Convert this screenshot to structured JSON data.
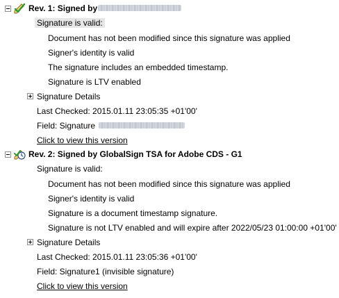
{
  "rev1": {
    "title": "Rev. 1: Signed by",
    "status": "Signature is valid:",
    "items": [
      "Document has not been modified since this signature was applied",
      "Signer's identity is valid",
      "The signature includes an embedded timestamp.",
      "Signature is LTV enabled"
    ],
    "details": "Signature Details",
    "last_checked": "Last Checked: 2015.01.11 23:05:35 +01'00'",
    "field": "Field: Signature",
    "view_link": "Click to view this version"
  },
  "rev2": {
    "title": "Rev. 2: Signed by GlobalSign TSA for Adobe CDS - G1",
    "status": "Signature is valid:",
    "items": [
      "Document has not been modified since this signature was applied",
      "Signer's identity is valid",
      "Signature is a document timestamp signature.",
      "Signature is not LTV enabled and will expire after 2022/05/23 01:00:00 +01'00'"
    ],
    "details": "Signature Details",
    "last_checked": "Last Checked: 2015.01.11 23:05:36 +01'00'",
    "field": "Field: Signature1 (invisible signature)",
    "view_link": "Click to view this version"
  },
  "icons": {
    "rev1_icon": "signature-valid-check-icon",
    "rev2_icon": "timestamp-signature-icon"
  }
}
